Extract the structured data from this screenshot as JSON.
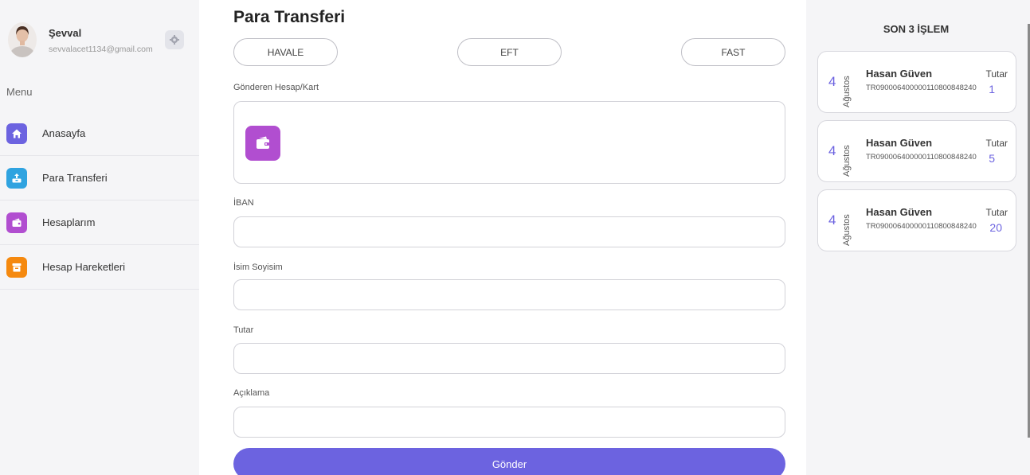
{
  "profile": {
    "name": "Şevval",
    "email": "sevvalacet1134@gmail.com",
    "avatar_icon": "user-avatar",
    "settings_icon": "gear-icon"
  },
  "sidebar": {
    "menu_label": "Menu",
    "items": [
      {
        "label": "Anasayfa",
        "icon": "home-icon",
        "color": "#6c63e0"
      },
      {
        "label": "Para Transferi",
        "icon": "transfer-icon",
        "color": "#2fa3e0"
      },
      {
        "label": "Hesaplarım",
        "icon": "wallet-icon",
        "color": "#b14ed0"
      },
      {
        "label": "Hesap Hareketleri",
        "icon": "archive-icon",
        "color": "#f5890f"
      }
    ]
  },
  "main": {
    "title": "Para Transferi",
    "tabs": [
      "HAVALE",
      "EFT",
      "FAST"
    ],
    "sender_label": "Gönderen Hesap/Kart",
    "sender_card_icon": "wallet-icon",
    "iban_label": "İBAN",
    "iban_value": "",
    "name_label": "İsim Soyisim",
    "name_value": "",
    "amount_label": "Tutar",
    "amount_value": "",
    "description_label": "Açıklama",
    "description_value": "",
    "submit_label": "Gönder"
  },
  "colors": {
    "accent": "#6c63e0",
    "sidebar_bg": "#f5f5f7"
  },
  "recent": {
    "title": "SON 3 İŞLEM",
    "transactions": [
      {
        "day": "4",
        "month": "Ağustos",
        "name": "Hasan Güven",
        "iban": "TR090006400000110800848240",
        "amount_label": "Tutar",
        "amount": "1"
      },
      {
        "day": "4",
        "month": "Ağustos",
        "name": "Hasan Güven",
        "iban": "TR090006400000110800848240",
        "amount_label": "Tutar",
        "amount": "5"
      },
      {
        "day": "4",
        "month": "Ağustos",
        "name": "Hasan Güven",
        "iban": "TR090006400000110800848240",
        "amount_label": "Tutar",
        "amount": "20"
      }
    ]
  }
}
